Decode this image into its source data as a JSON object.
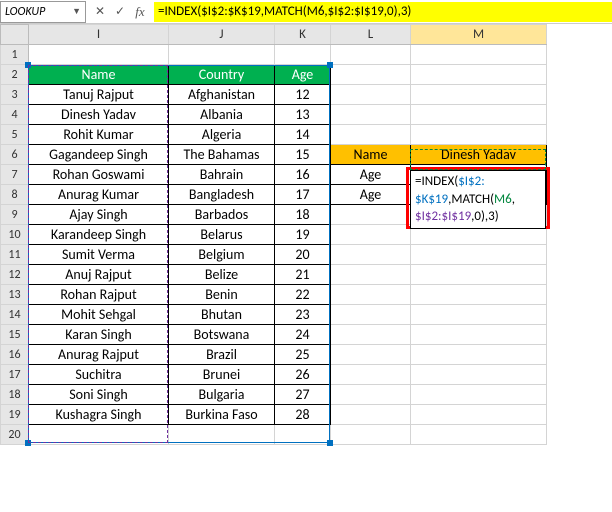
{
  "nameBox": "LOOKUP",
  "formula": "=INDEX($I$2:$K$19,MATCH(M6,$I$2:$I$19,0),3)",
  "columns": [
    "I",
    "J",
    "K",
    "L",
    "M"
  ],
  "rows": [
    "1",
    "2",
    "3",
    "4",
    "5",
    "6",
    "7",
    "8",
    "9",
    "10",
    "11",
    "12",
    "13",
    "14",
    "15",
    "16",
    "17",
    "18",
    "19",
    "20"
  ],
  "headers": {
    "name": "Name",
    "country": "Country",
    "age": "Age"
  },
  "table": [
    {
      "name": "Tanuj Rajput",
      "country": "Afghanistan",
      "age": "12"
    },
    {
      "name": "Dinesh Yadav",
      "country": "Albania",
      "age": "13"
    },
    {
      "name": "Rohit Kumar",
      "country": "Algeria",
      "age": "14"
    },
    {
      "name": "Gagandeep Singh",
      "country": "The Bahamas",
      "age": "15"
    },
    {
      "name": "Rohan Goswami",
      "country": "Bahrain",
      "age": "16"
    },
    {
      "name": "Anurag Kumar",
      "country": "Bangladesh",
      "age": "17"
    },
    {
      "name": "Ajay Singh",
      "country": "Barbados",
      "age": "18"
    },
    {
      "name": "Karandeep Singh",
      "country": "Belarus",
      "age": "19"
    },
    {
      "name": "Sumit Verma",
      "country": "Belgium",
      "age": "20"
    },
    {
      "name": "Anuj Rajput",
      "country": "Belize",
      "age": "21"
    },
    {
      "name": "Rohan Rajput",
      "country": "Benin",
      "age": "22"
    },
    {
      "name": "Mohit Sehgal",
      "country": "Bhutan",
      "age": "23"
    },
    {
      "name": "Karan Singh",
      "country": "Botswana",
      "age": "24"
    },
    {
      "name": "Anurag Rajput",
      "country": "Brazil",
      "age": "25"
    },
    {
      "name": "Suchitra",
      "country": "Brunei",
      "age": "26"
    },
    {
      "name": "Soni Singh",
      "country": "Bulgaria",
      "age": "27"
    },
    {
      "name": "Kushagra Singh",
      "country": "Burkina Faso",
      "age": "28"
    }
  ],
  "lookup": {
    "nameHeader": "Name",
    "nameValue": "Dinesh Yadav",
    "ageLabel1": "Age",
    "ageLabel2": "Age"
  },
  "cellFormula": {
    "p1": "=INDEX(",
    "p2": "$I$2:",
    "p3": "$K$19",
    "p4": ",MATCH(",
    "p5": "M6",
    "p6": ",",
    "p7": "$I$2:$I$19",
    "p8": ",0),3)"
  }
}
